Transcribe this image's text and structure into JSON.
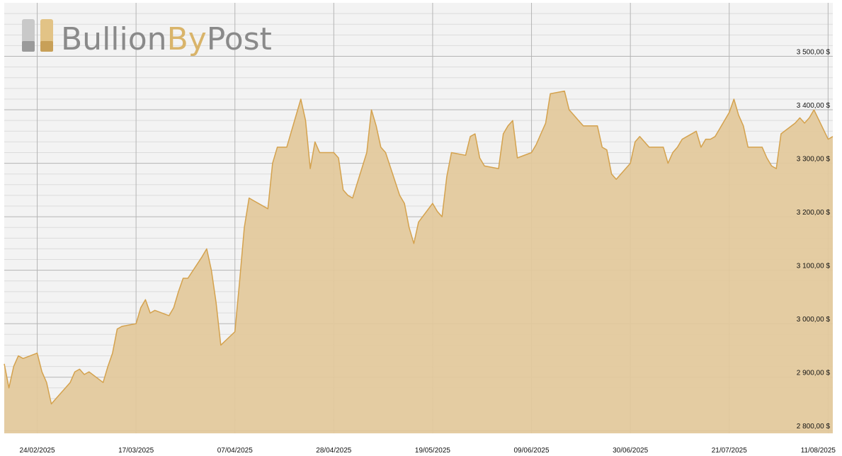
{
  "brand": {
    "name_part1": "Bullion",
    "name_part2": "By",
    "name_part3": "Post"
  },
  "colors": {
    "plot_bg": "#f3f3f3",
    "fill": "#e3c99b",
    "line": "#d4a24e",
    "grid_major": "#b5b5b5",
    "grid_minor": "#dcdcdc",
    "logo_grey": "#8a8a8a",
    "logo_gold": "#d9b46a"
  },
  "chart_data": {
    "type": "area",
    "title": "",
    "xlabel": "",
    "ylabel": "",
    "currency_suffix": "$",
    "ylim": [
      2795,
      3600
    ],
    "xlim": [
      "2025-02-17",
      "2025-08-12"
    ],
    "y_ticks": [
      2800,
      2900,
      3000,
      3100,
      3200,
      3300,
      3400,
      3500
    ],
    "y_tick_labels": [
      "2 800,00 $",
      "2 900,00 $",
      "3 000,00 $",
      "3 100,00 $",
      "3 200,00 $",
      "3 300,00 $",
      "3 400,00 $",
      "3 500,00 $"
    ],
    "x_ticks": [
      "2025-02-24",
      "2025-03-17",
      "2025-04-07",
      "2025-04-28",
      "2025-05-19",
      "2025-06-09",
      "2025-06-30",
      "2025-07-21",
      "2025-08-11"
    ],
    "x_tick_labels": [
      "24/02/2025",
      "17/03/2025",
      "07/04/2025",
      "28/04/2025",
      "19/05/2025",
      "09/06/2025",
      "30/06/2025",
      "21/07/2025",
      "11/08/2025"
    ],
    "grid": true,
    "legend": "none",
    "series": [
      {
        "x": [
          "2025-02-17",
          "2025-02-18",
          "2025-02-19",
          "2025-02-20",
          "2025-02-21",
          "2025-02-24",
          "2025-02-25",
          "2025-02-26",
          "2025-02-27",
          "2025-02-28",
          "2025-03-03",
          "2025-03-04",
          "2025-03-05",
          "2025-03-06",
          "2025-03-07",
          "2025-03-10",
          "2025-03-11",
          "2025-03-12",
          "2025-03-13",
          "2025-03-14",
          "2025-03-17",
          "2025-03-18",
          "2025-03-19",
          "2025-03-20",
          "2025-03-21",
          "2025-03-24",
          "2025-03-25",
          "2025-03-26",
          "2025-03-27",
          "2025-03-28",
          "2025-03-31",
          "2025-04-01",
          "2025-04-02",
          "2025-04-03",
          "2025-04-04",
          "2025-04-07",
          "2025-04-08",
          "2025-04-09",
          "2025-04-10",
          "2025-04-11",
          "2025-04-14",
          "2025-04-15",
          "2025-04-16",
          "2025-04-17",
          "2025-04-18",
          "2025-04-21",
          "2025-04-22",
          "2025-04-23",
          "2025-04-24",
          "2025-04-25",
          "2025-04-28",
          "2025-04-29",
          "2025-04-30",
          "2025-05-01",
          "2025-05-02",
          "2025-05-05",
          "2025-05-06",
          "2025-05-07",
          "2025-05-08",
          "2025-05-09",
          "2025-05-12",
          "2025-05-13",
          "2025-05-14",
          "2025-05-15",
          "2025-05-16",
          "2025-05-19",
          "2025-05-20",
          "2025-05-21",
          "2025-05-22",
          "2025-05-23",
          "2025-05-26",
          "2025-05-27",
          "2025-05-28",
          "2025-05-29",
          "2025-05-30",
          "2025-06-02",
          "2025-06-03",
          "2025-06-04",
          "2025-06-05",
          "2025-06-06",
          "2025-06-09",
          "2025-06-10",
          "2025-06-11",
          "2025-06-12",
          "2025-06-13",
          "2025-06-16",
          "2025-06-17",
          "2025-06-18",
          "2025-06-19",
          "2025-06-20",
          "2025-06-23",
          "2025-06-24",
          "2025-06-25",
          "2025-06-26",
          "2025-06-27",
          "2025-06-30",
          "2025-07-01",
          "2025-07-02",
          "2025-07-03",
          "2025-07-04",
          "2025-07-07",
          "2025-07-08",
          "2025-07-09",
          "2025-07-10",
          "2025-07-11",
          "2025-07-14",
          "2025-07-15",
          "2025-07-16",
          "2025-07-17",
          "2025-07-18",
          "2025-07-21",
          "2025-07-22",
          "2025-07-23",
          "2025-07-24",
          "2025-07-25",
          "2025-07-28",
          "2025-07-29",
          "2025-07-30",
          "2025-07-31",
          "2025-08-01",
          "2025-08-04",
          "2025-08-05",
          "2025-08-06",
          "2025-08-07",
          "2025-08-08",
          "2025-08-11",
          "2025-08-12"
        ],
        "values": [
          2925,
          2880,
          2920,
          2940,
          2935,
          2945,
          2910,
          2890,
          2850,
          2860,
          2890,
          2910,
          2915,
          2905,
          2910,
          2890,
          2920,
          2945,
          2990,
          2995,
          3000,
          3030,
          3045,
          3020,
          3025,
          3015,
          3030,
          3060,
          3085,
          3085,
          3125,
          3140,
          3100,
          3040,
          2960,
          2985,
          3080,
          3180,
          3235,
          3230,
          3215,
          3300,
          3330,
          3330,
          3330,
          3420,
          3380,
          3290,
          3340,
          3320,
          3320,
          3310,
          3250,
          3240,
          3235,
          3320,
          3400,
          3370,
          3330,
          3320,
          3240,
          3225,
          3180,
          3150,
          3190,
          3225,
          3210,
          3200,
          3275,
          3320,
          3315,
          3350,
          3355,
          3310,
          3295,
          3290,
          3355,
          3370,
          3380,
          3310,
          3320,
          3335,
          3355,
          3375,
          3430,
          3435,
          3400,
          3390,
          3380,
          3370,
          3370,
          3330,
          3325,
          3280,
          3270,
          3300,
          3340,
          3350,
          3340,
          3330,
          3330,
          3300,
          3320,
          3330,
          3345,
          3360,
          3330,
          3345,
          3345,
          3350,
          3395,
          3420,
          3390,
          3370,
          3330,
          3330,
          3310,
          3295,
          3290,
          3355,
          3375,
          3385,
          3375,
          3385,
          3400,
          3345,
          3350
        ]
      }
    ]
  }
}
